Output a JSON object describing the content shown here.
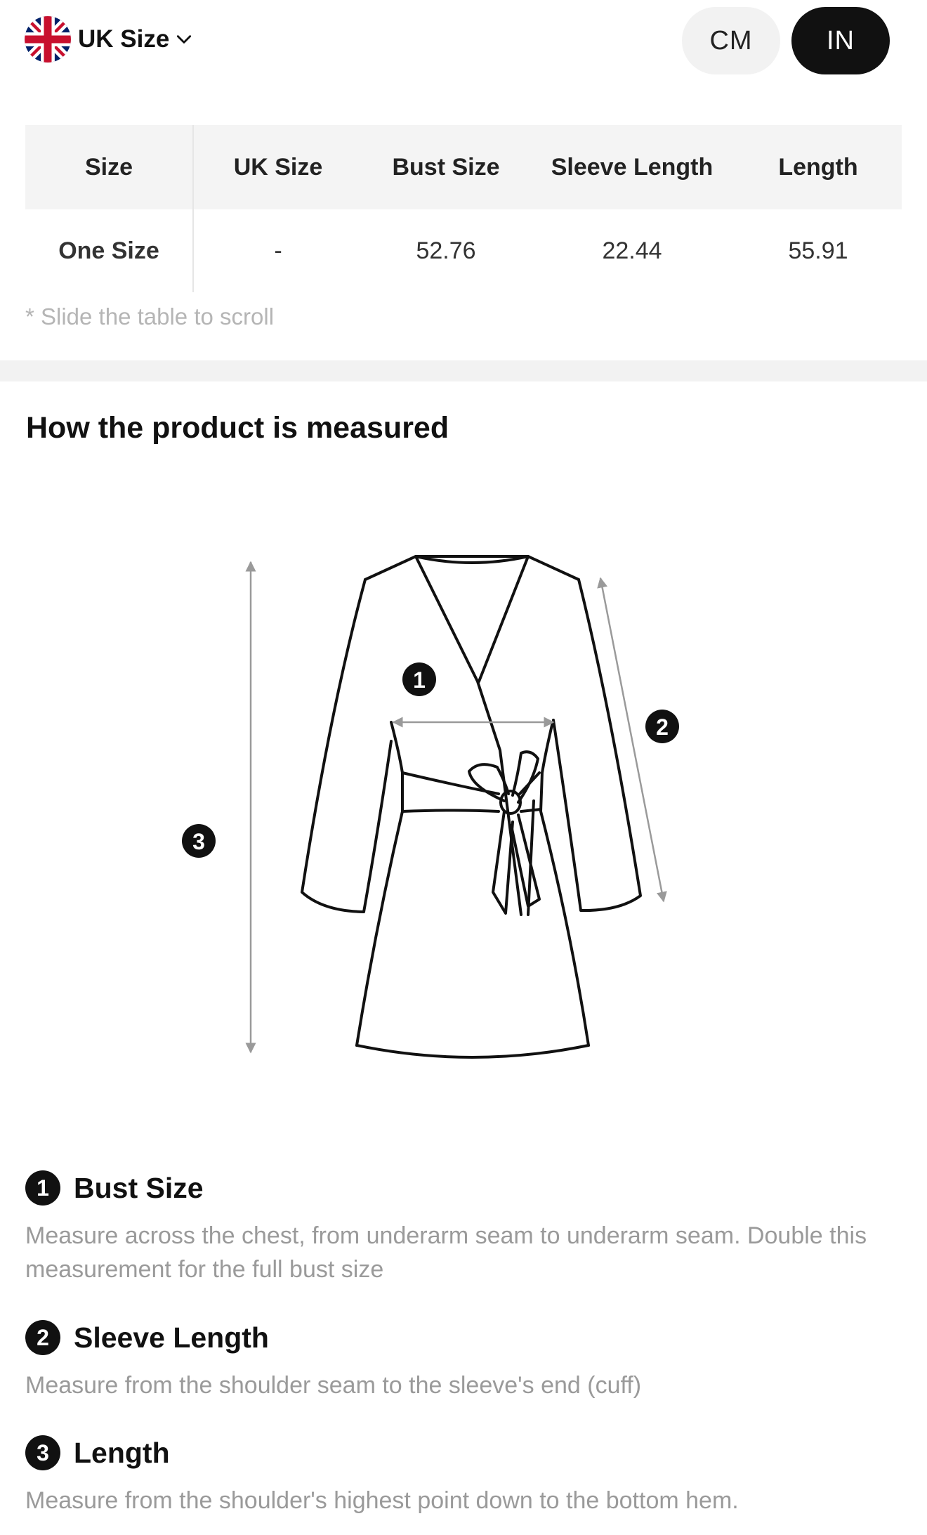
{
  "header": {
    "size_system_label": "UK Size",
    "flag_icon": "uk-flag-icon",
    "units": [
      {
        "label": "CM",
        "selected": false
      },
      {
        "label": "IN",
        "selected": true
      }
    ]
  },
  "table": {
    "headers": [
      "Size",
      "UK Size",
      "Bust Size",
      "Sleeve Length",
      "Length"
    ],
    "rows": [
      [
        "One Size",
        "-",
        "52.76",
        "22.44",
        "55.91"
      ]
    ],
    "scroll_hint": "* Slide the table to scroll"
  },
  "measure": {
    "title": "How the product is measured",
    "items": [
      {
        "number": "1",
        "title": "Bust Size",
        "description": "Measure across the chest, from underarm seam to underarm seam. Double this measurement for the full bust size"
      },
      {
        "number": "2",
        "title": "Sleeve Length",
        "description": "Measure from the shoulder seam to the sleeve's end (cuff)"
      },
      {
        "number": "3",
        "title": "Length",
        "description": "Measure from the shoulder's highest point down to the bottom hem."
      }
    ]
  },
  "colors": {
    "selected_unit_bg": "#111111",
    "unselected_unit_bg": "#f2f2f2",
    "table_header_bg": "#f4f4f4",
    "muted_text": "#9a9a9a"
  }
}
